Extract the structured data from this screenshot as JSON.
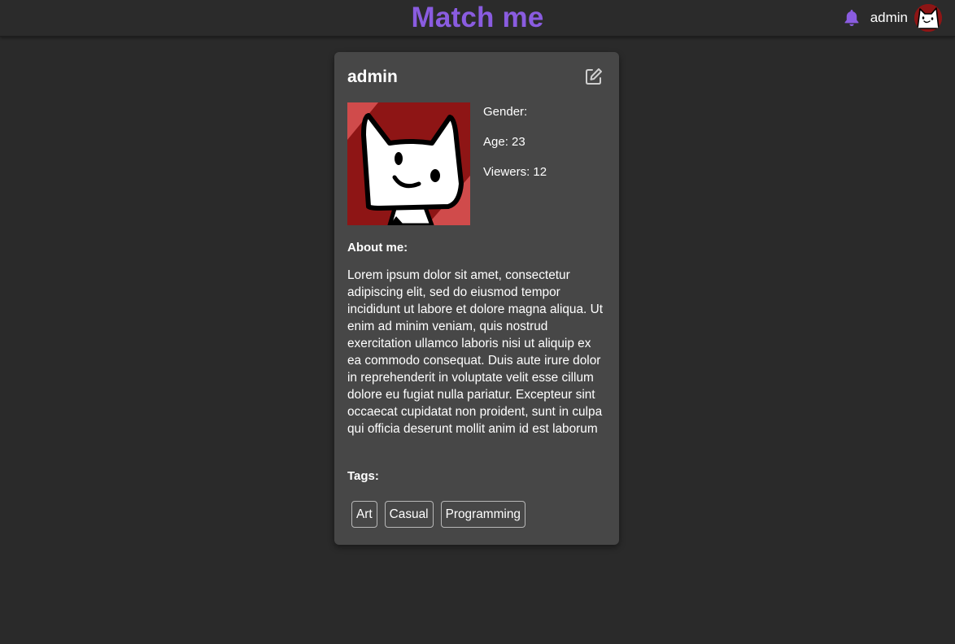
{
  "header": {
    "brand": "Match me",
    "username": "admin",
    "icons": {
      "notifications": "bell-icon",
      "avatar": "cat-avatar"
    },
    "accent_color": "#8a5ce0"
  },
  "profile": {
    "name": "admin",
    "edit_icon": "edit-icon",
    "gender_label": "Gender:",
    "age_label": "Age: 23",
    "viewers_label": "Viewers: 12",
    "about_heading": "About me:",
    "about_text": "Lorem ipsum dolor sit amet, consectetur adipiscing elit, sed do eiusmod tempor incididunt ut labore et dolore magna aliqua. Ut enim ad minim veniam, quis nostrud exercitation ullamco laboris nisi ut aliquip ex ea commodo consequat. Duis aute irure dolor in reprehenderit in voluptate velit esse cillum dolore eu fugiat nulla pariatur. Excepteur sint occaecat cupidatat non proident, sunt in culpa qui officia deserunt mollit anim id est laborum",
    "tags_heading": "Tags:",
    "tags": [
      "Art",
      "Casual",
      "Programming"
    ]
  },
  "colors": {
    "background": "#2a2a2a",
    "card": "#474747",
    "avatar_red": "#8e1515"
  }
}
